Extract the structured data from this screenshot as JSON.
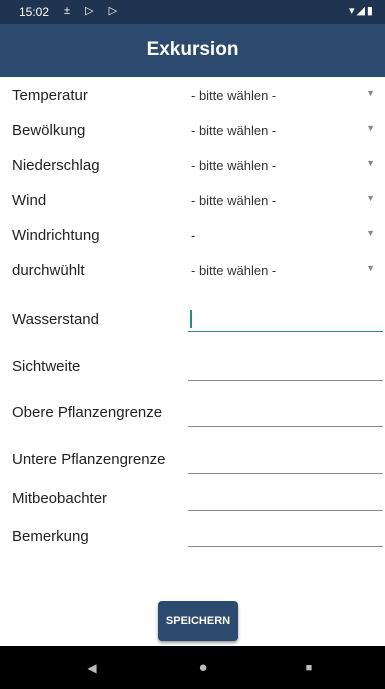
{
  "status_bar": {
    "time": "15:02",
    "left_icons": "± ▷ ▷",
    "right_icons": "▾◢▮"
  },
  "app_bar": {
    "title": "Exkursion"
  },
  "fields": [
    {
      "label": "Temperatur",
      "value": "- bitte wählen -"
    },
    {
      "label": "Bewölkung",
      "value": "- bitte wählen -"
    },
    {
      "label": "Niederschlag",
      "value": "- bitte wählen -"
    },
    {
      "label": "Wind",
      "value": "- bitte wählen -"
    },
    {
      "label": "Windrichtung",
      "value": "-"
    },
    {
      "label": "durchwühlt",
      "value": "- bitte wählen -"
    },
    {
      "label": "Wasserstand",
      "value": ""
    },
    {
      "label": "Sichtweite",
      "value": ""
    },
    {
      "label": "Obere Pflanzengrenze",
      "value": ""
    },
    {
      "label": "Untere Pflanzengrenze",
      "value": ""
    },
    {
      "label": "Mitbeobachter",
      "value": ""
    },
    {
      "label": "Bemerkung",
      "value": ""
    }
  ],
  "save_button": {
    "label": "SPEICHERN"
  },
  "nav_bar": {
    "back_icon": "◀",
    "home_icon": "●",
    "recents_icon": "■"
  },
  "colors": {
    "primary": "#2c4a6e",
    "status_bar": "#1f3450",
    "accent": "#2e8b7b"
  }
}
